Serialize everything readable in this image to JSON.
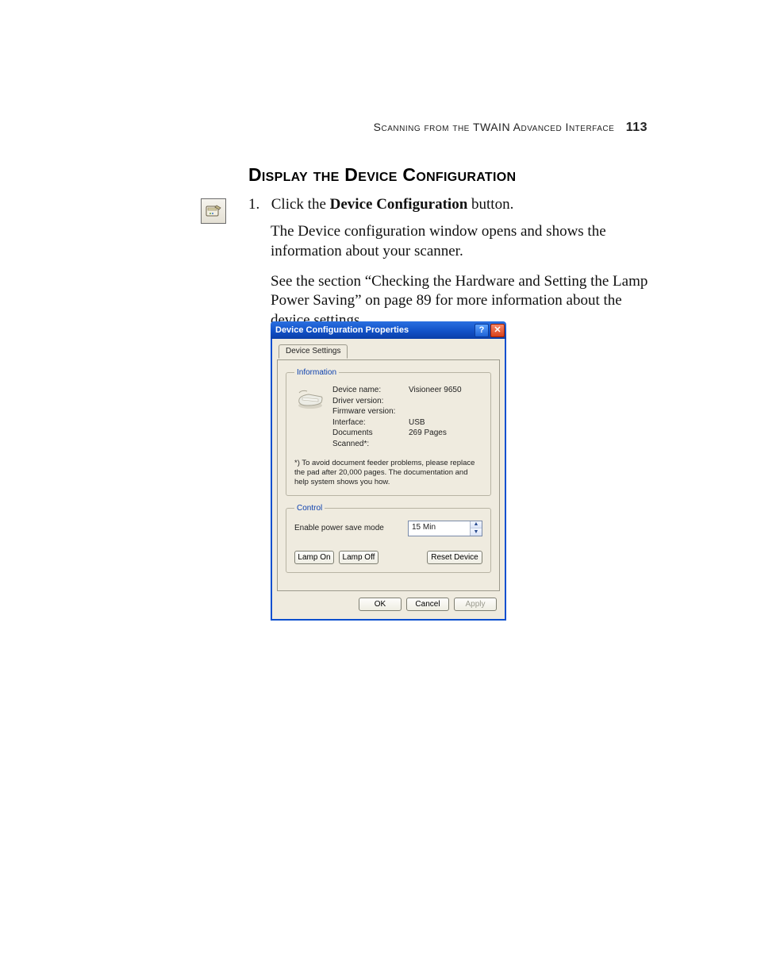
{
  "header": {
    "running_head": "Scanning from the TWAIN Advanced Interface",
    "page_number": "113"
  },
  "section": {
    "heading": "Display the Device Configuration"
  },
  "step": {
    "number": "1.",
    "prefix": "Click the ",
    "bold": "Device Configuration",
    "suffix": " button.",
    "para2": "The Device configuration window opens and shows the information about your scanner.",
    "para3": "See the section “Checking the Hardware and Setting the Lamp Power Saving” on page 89 for more information about the device settings."
  },
  "dialog": {
    "title": "Device Configuration Properties",
    "tab_label": "Device Settings",
    "info": {
      "legend": "Information",
      "rows": [
        {
          "k": "Device name:",
          "v": "Visioneer 9650"
        },
        {
          "k": "Driver version:",
          "v": ""
        },
        {
          "k": "Firmware version:",
          "v": ""
        },
        {
          "k": "Interface:",
          "v": "USB"
        },
        {
          "k": "Documents Scanned*:",
          "v": "269 Pages"
        }
      ],
      "footnote": "*) To avoid document feeder problems, please replace the pad after 20,000 pages. The documentation and help system shows you how."
    },
    "control": {
      "legend": "Control",
      "power_save_label": "Enable power save mode",
      "power_save_value": "15 Min",
      "lamp_on": "Lamp On",
      "lamp_off": "Lamp Off",
      "reset": "Reset Device"
    },
    "footer": {
      "ok": "OK",
      "cancel": "Cancel",
      "apply": "Apply"
    }
  }
}
